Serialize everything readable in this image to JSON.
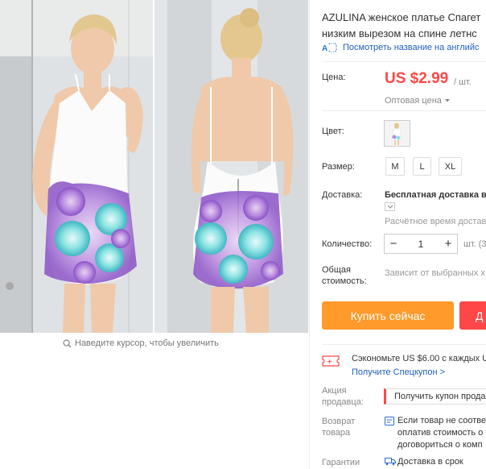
{
  "product": {
    "title_line1": "AZULINA женское платье Спагет",
    "title_line2": "низким вырезом на спине летнс",
    "translate_icon": "translate-ai-icon",
    "translate_link": "Посмотреть название на английс"
  },
  "price": {
    "label": "Цена:",
    "value": "US $2.99",
    "unit": "/ шт.",
    "wholesale": "Оптовая цена",
    "color": "#ff4747"
  },
  "color": {
    "label": "Цвет:"
  },
  "size": {
    "label": "Размер:",
    "options": [
      "M",
      "L",
      "XL"
    ]
  },
  "shipping": {
    "label": "Доставка:",
    "free": "Бесплатная доставка в",
    "estimate": "Расчётное время достав"
  },
  "quantity": {
    "label": "Количество:",
    "minus": "−",
    "value": "1",
    "plus": "+",
    "unit": "шт. (3"
  },
  "total": {
    "label_line1": "Общая",
    "label_line2": "стоимость:",
    "note": "Зависит от выбранных х"
  },
  "actions": {
    "buy_now": "Купить сейчас",
    "add_to_cart": "Д",
    "buy_color": "#ff9a2b",
    "cart_color": "#ff4747"
  },
  "coupon": {
    "icon": "coupon-icon",
    "save_text": "Сэкономьте US $6.00 с каждых U",
    "get_code": "Получите Спецкупон >"
  },
  "seller_promo": {
    "label_line1": "Акция",
    "label_line2": "продавца:",
    "button": "Получить купон прода"
  },
  "returns": {
    "label_line1": "Возврат",
    "label_line2": "товара",
    "lines": [
      "Если товар не соотве",
      "оплатив стоимость о",
      "договориться о комп"
    ]
  },
  "guarantee": {
    "label": "Гарантии",
    "text": "Доставка в срок"
  },
  "gallery": {
    "zoom_hint": "Наведите курсор, чтобы увеличить"
  }
}
